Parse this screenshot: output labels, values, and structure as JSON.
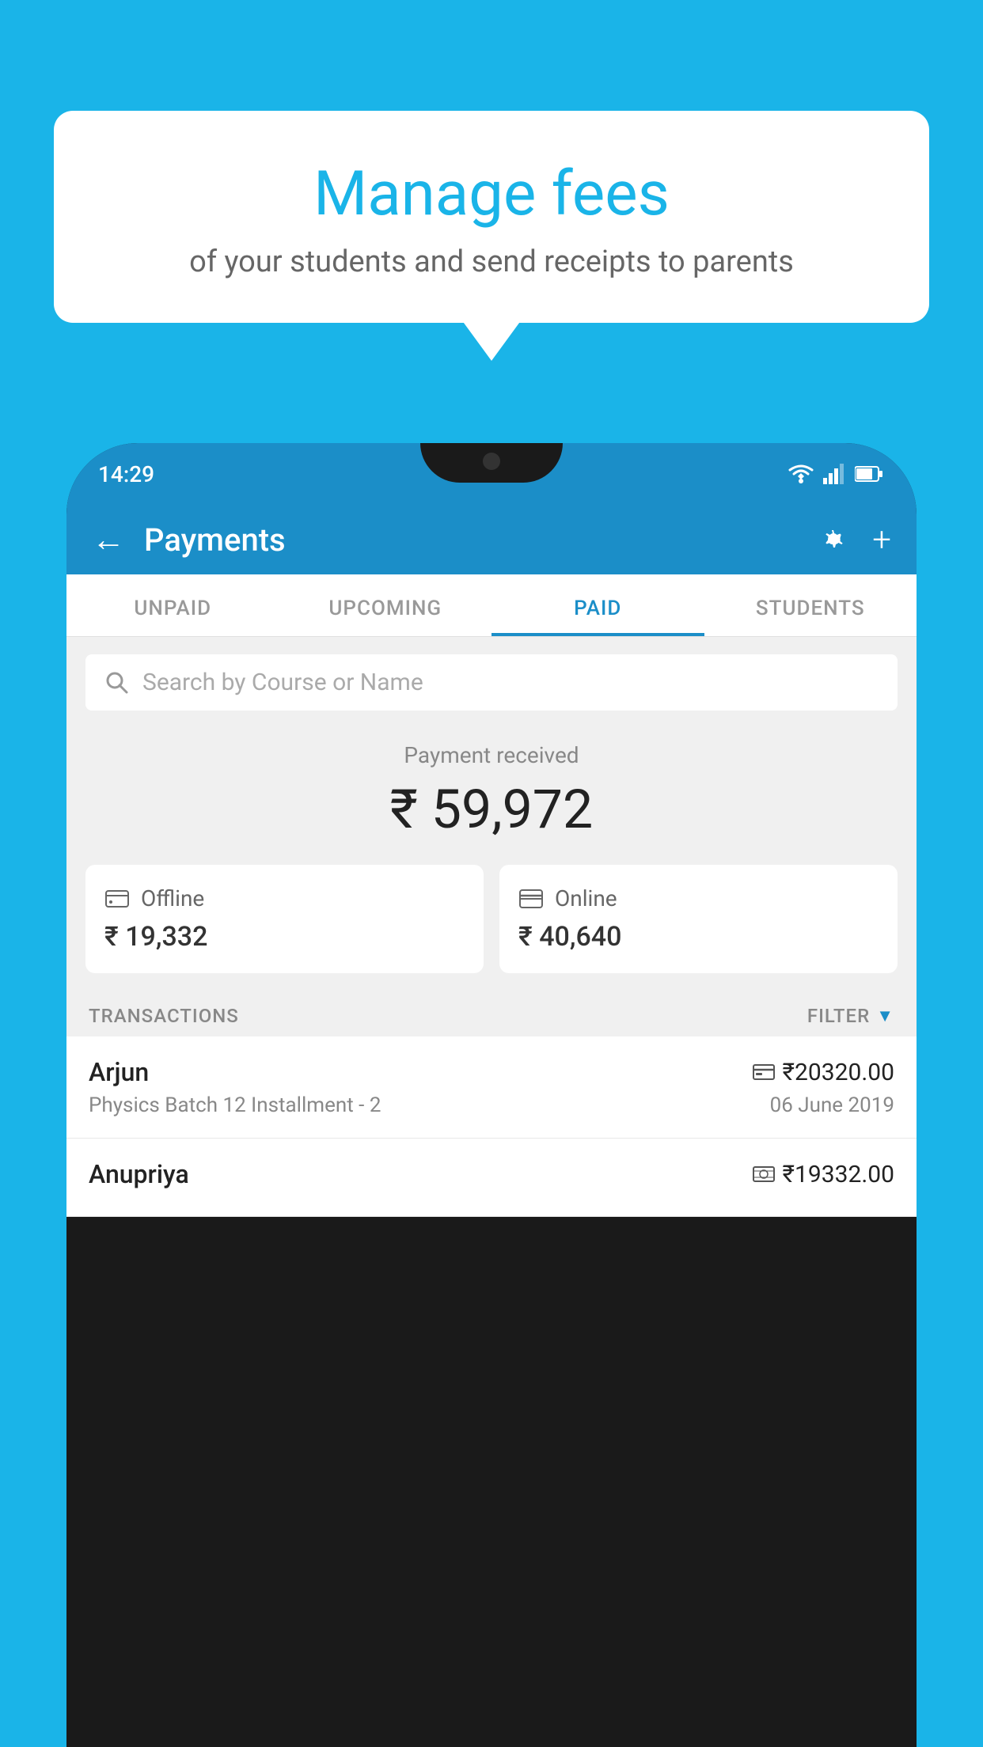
{
  "background_color": "#1ab4e8",
  "speech_bubble": {
    "title": "Manage fees",
    "subtitle": "of your students and send receipts to parents"
  },
  "phone": {
    "status_bar": {
      "time": "14:29"
    },
    "header": {
      "title": "Payments",
      "back_label": "←",
      "gear_label": "⚙",
      "plus_label": "+"
    },
    "tabs": [
      {
        "label": "UNPAID",
        "active": false
      },
      {
        "label": "UPCOMING",
        "active": false
      },
      {
        "label": "PAID",
        "active": true
      },
      {
        "label": "STUDENTS",
        "active": false
      }
    ],
    "search": {
      "placeholder": "Search by Course or Name"
    },
    "payment_received": {
      "label": "Payment received",
      "amount": "₹ 59,972"
    },
    "payment_cards": [
      {
        "icon": "offline",
        "label": "Offline",
        "amount": "₹ 19,332"
      },
      {
        "icon": "online",
        "label": "Online",
        "amount": "₹ 40,640"
      }
    ],
    "transactions_header": {
      "label": "TRANSACTIONS",
      "filter_label": "FILTER"
    },
    "transactions": [
      {
        "name": "Arjun",
        "course": "Physics Batch 12 Installment - 2",
        "amount": "₹20320.00",
        "date": "06 June 2019",
        "payment_type": "card"
      },
      {
        "name": "Anupriya",
        "course": "",
        "amount": "₹19332.00",
        "date": "",
        "payment_type": "cash"
      }
    ]
  }
}
